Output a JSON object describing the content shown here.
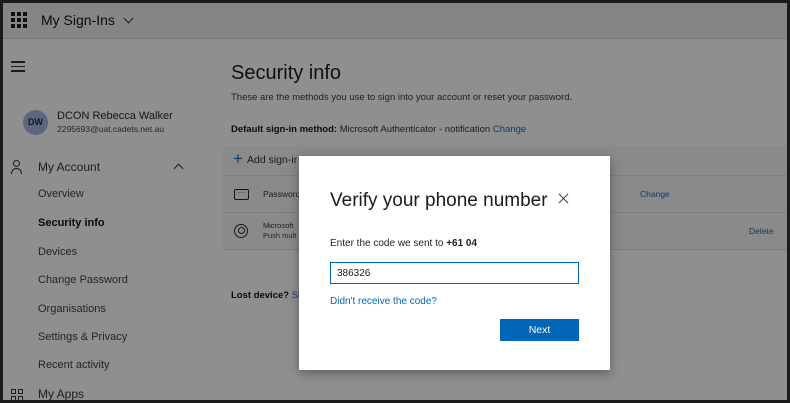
{
  "header": {
    "app_title": "My Sign-Ins"
  },
  "user": {
    "initials": "DW",
    "name": "DCON Rebecca Walker",
    "email": "2295693@uat.cadets.net.au"
  },
  "sidebar": {
    "my_account_label": "My Account",
    "items": [
      {
        "label": "Overview"
      },
      {
        "label": "Security info"
      },
      {
        "label": "Devices"
      },
      {
        "label": "Change Password"
      },
      {
        "label": "Organisations"
      },
      {
        "label": "Settings & Privacy"
      },
      {
        "label": "Recent activity"
      }
    ],
    "my_apps_label": "My Apps"
  },
  "main": {
    "title": "Security info",
    "description": "These are the methods you use to sign into your account or reset your password.",
    "default_method_label": "Default sign-in method:",
    "default_method_value": "Microsoft Authenticator - notification",
    "default_method_change": "Change",
    "add_method_label": "Add sign-ir",
    "methods": [
      {
        "label": "Password",
        "action": "Change"
      },
      {
        "label": "Microsoft",
        "sublabel": "Push mult",
        "action": "Delete"
      }
    ],
    "lost_device_label": "Lost device?",
    "lost_device_link": "Sign"
  },
  "dialog": {
    "title": "Verify your phone number",
    "prompt": "Enter the code we sent to",
    "phone": "+61 04",
    "code_value": "386326",
    "resend_link": "Didn't receive the code?",
    "next_label": "Next"
  },
  "colors": {
    "accent": "#0067b8",
    "overlay_background": "#8f8f8f",
    "dialog_background": "#ffffff"
  }
}
